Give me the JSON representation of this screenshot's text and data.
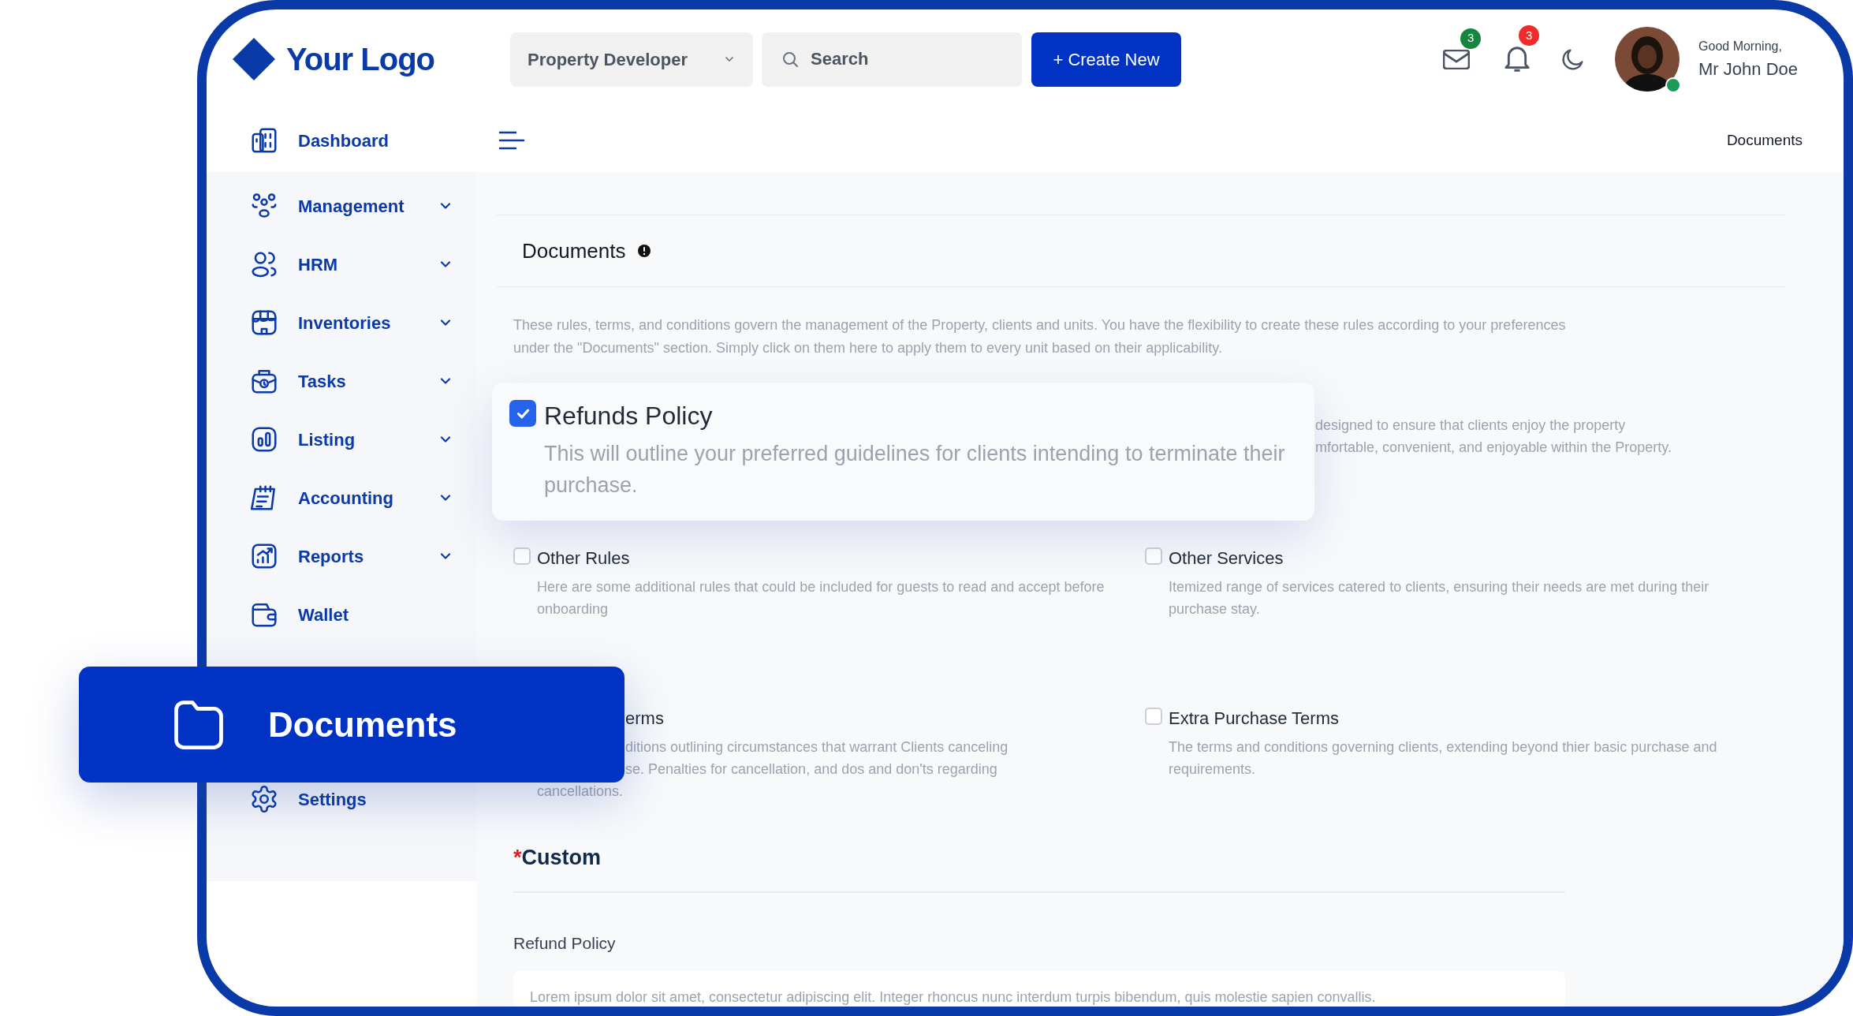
{
  "header": {
    "logo": "Your Logo",
    "role_select": "Property Developer",
    "search": {
      "placeholder": "Search"
    },
    "create_button": "+ Create New",
    "mail_count": "3",
    "notification_count": "3",
    "greeting": "Good Morning,",
    "user_name": "Mr John Doe",
    "online": true
  },
  "breadcrumb": "Documents",
  "sidebar": {
    "items": [
      {
        "label": "Dashboard",
        "expandable": false
      },
      {
        "label": "Management",
        "expandable": true
      },
      {
        "label": "HRM",
        "expandable": true
      },
      {
        "label": "Inventories",
        "expandable": true
      },
      {
        "label": "Tasks",
        "expandable": true
      },
      {
        "label": "Listing",
        "expandable": true
      },
      {
        "label": "Accounting",
        "expandable": true
      },
      {
        "label": "Reports",
        "expandable": true
      },
      {
        "label": "Wallet",
        "expandable": false
      },
      {
        "label": "Settings",
        "expandable": false
      }
    ]
  },
  "page": {
    "title": "Documents",
    "intro": "These rules, terms, and conditions govern the management of the Property, clients and units. You have the flexibility to create these rules according to your preferences under the \"Documents\" section. Simply click on them here to apply them to every unit based on their applicability.",
    "rules": [
      {
        "kind": "covered_right",
        "description": "designed to ensure that clients enjoy the property\nmfortable, convenient, and enjoyable within the Property."
      },
      {
        "kind": "full",
        "title": "Other Rules",
        "description": "Here are some additional rules that could be included for guests to read and accept before onboarding",
        "checked": false
      },
      {
        "kind": "full",
        "title": "Other Services",
        "description": "Itemized range of services catered to clients, ensuring their needs are met during their purchase stay.",
        "checked": false
      },
      {
        "kind": "covered_left",
        "title": "erms",
        "description": "ditions outlining circumstances that warrant Clients canceling\nse. Penalties for cancellation, and dos and don'ts regarding",
        "tail": "cancellations."
      },
      {
        "kind": "full",
        "title": "Extra Purchase Terms",
        "description": "The terms and conditions governing clients, extending beyond thier basic purchase and requirements.",
        "checked": false
      }
    ],
    "custom": {
      "required_mark": "*",
      "title": "Custom",
      "field_label": "Refund Policy",
      "field_value": "Lorem ipsum dolor sit amet, consectetur adipiscing elit. Integer rhoncus nunc interdum turpis bibendum, quis molestie sapien convallis."
    }
  },
  "featured_rule": {
    "title": "Refunds Policy",
    "description": "This will outline your preferred guidelines for clients intending to terminate their purchase.",
    "checked": true
  },
  "active_nav": {
    "label": "Documents"
  }
}
